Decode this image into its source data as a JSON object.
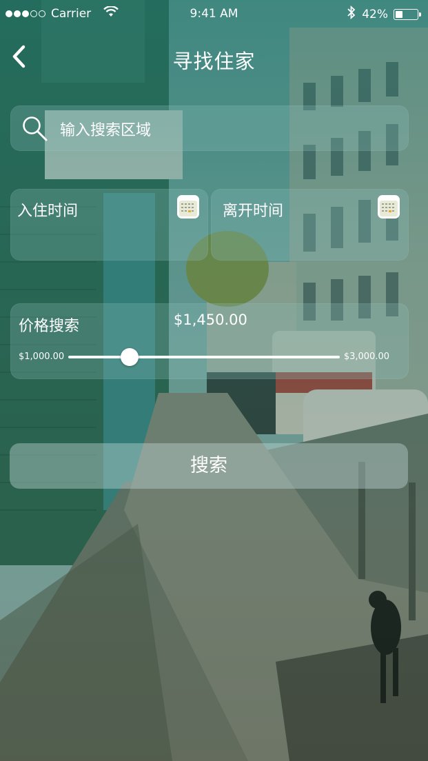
{
  "status_bar": {
    "carrier": "Carrier",
    "time": "9:41 AM",
    "battery": "42%",
    "battery_level": 0.42,
    "signal_bars_filled": 3,
    "signal_bars_total": 5
  },
  "nav": {
    "title": "寻找住家",
    "back_icon": "chevron-left-icon"
  },
  "search": {
    "placeholder": "输入搜索区域",
    "icon": "search-icon"
  },
  "dates": {
    "checkin_label": "入住时间",
    "checkout_label": "离开时间",
    "icon": "calendar-icon"
  },
  "price": {
    "label": "价格搜索",
    "current": "$1,450.00",
    "min_label": "$1,000.00",
    "max_label": "$3,000.00",
    "min": 1000,
    "max": 3000,
    "value": 1450
  },
  "actions": {
    "search_button": "搜索"
  },
  "colors": {
    "tint": "#1c6e66",
    "panel": "#8cbeb9",
    "text": "#ffffff"
  }
}
